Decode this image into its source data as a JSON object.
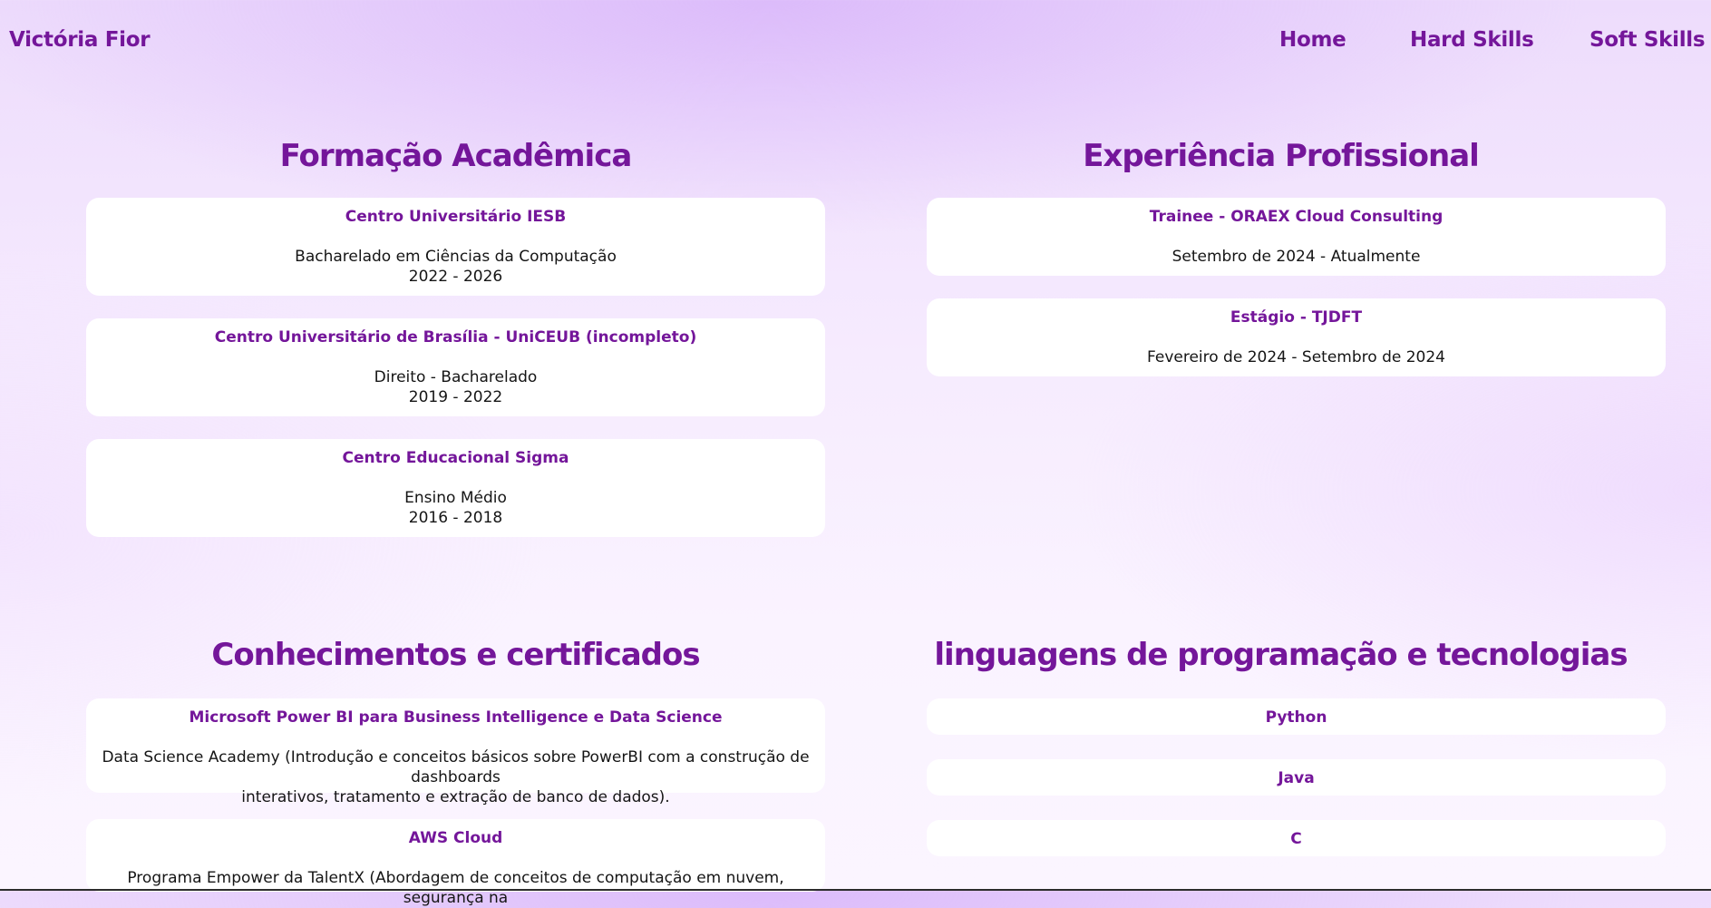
{
  "header": {
    "brand": "Victória Fior",
    "nav": [
      "Home",
      "Hard Skills",
      "Soft Skills"
    ]
  },
  "education": {
    "title": "Formação Acadêmica",
    "items": [
      {
        "institution": "Centro Universitário IESB",
        "course": "Bacharelado em Ciências da Computação",
        "period": "2022 - 2026"
      },
      {
        "institution": "Centro Universitário de Brasília - UniCEUB (incompleto)",
        "course": "Direito - Bacharelado",
        "period": "2019 - 2022"
      },
      {
        "institution": "Centro Educacional Sigma",
        "course": "Ensino Médio",
        "period": "2016 - 2018"
      }
    ]
  },
  "experience": {
    "title": "Experiência Profissional",
    "items": [
      {
        "role": "Trainee - ORAEX Cloud Consulting",
        "period": "Setembro de 2024 - Atualmente"
      },
      {
        "role": "Estágio - TJDFT",
        "period": "Fevereiro de 2024 - Setembro de 2024"
      }
    ]
  },
  "certificates": {
    "title": "Conhecimentos e certificados",
    "items": [
      {
        "name": "Microsoft Power BI para Business Intelligence e Data Science",
        "description_line1": "Data Science Academy (Introdução e conceitos básicos sobre PowerBI com a construção de dashboards",
        "description_line2": "interativos, tratamento e extração de banco de dados)."
      },
      {
        "name": "AWS Cloud",
        "description_line1": "Programa Empower da TalentX (Abordagem de conceitos de computação em nuvem, segurança na"
      }
    ]
  },
  "languages": {
    "title": "linguagens de programação e tecnologias",
    "items": [
      "Python",
      "Java",
      "C"
    ]
  },
  "colors": {
    "accent": "#74169a",
    "card_background": "#ffffff",
    "text": "#151515",
    "background_top": "#eddcfc",
    "background_bottom": "#fbf5ff"
  }
}
